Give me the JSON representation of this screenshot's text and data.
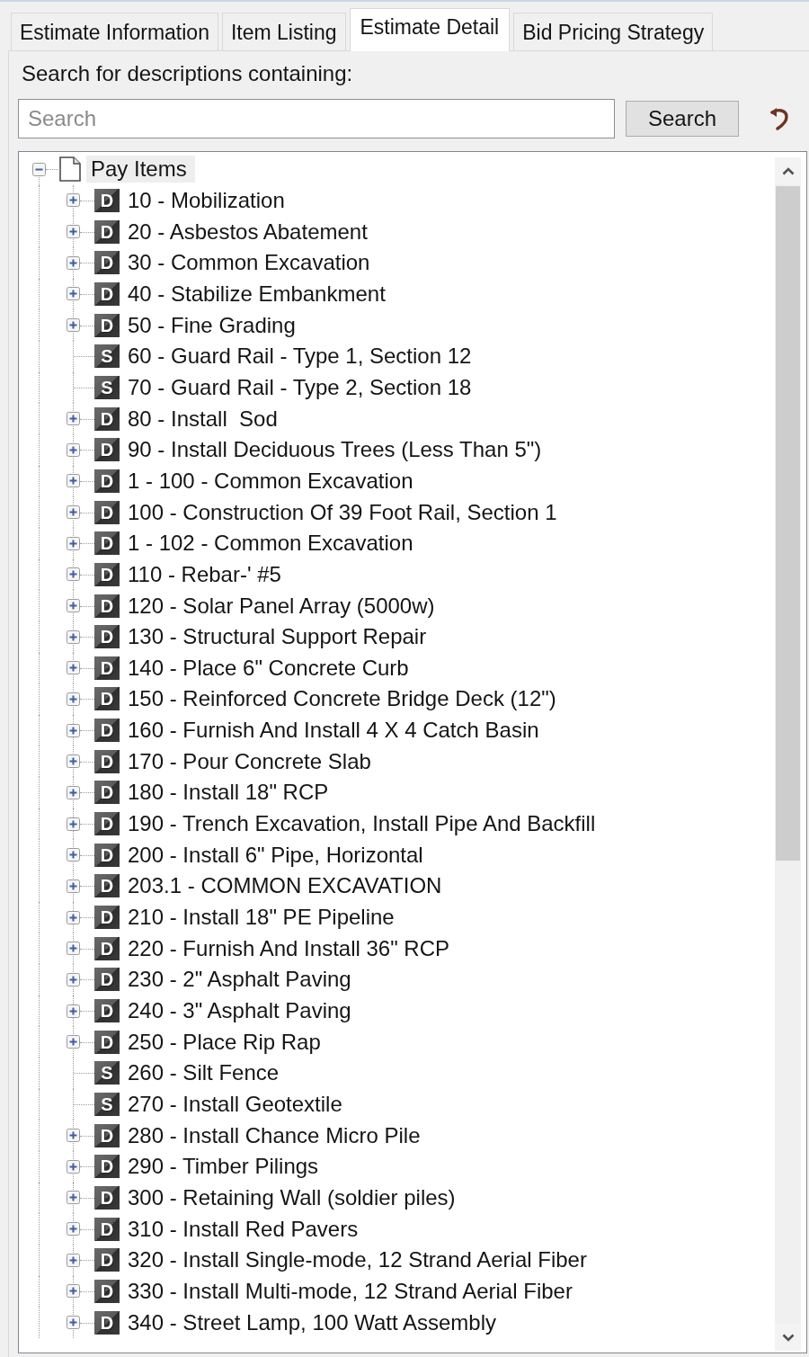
{
  "tabs": [
    {
      "label": "Estimate Information",
      "selected": false
    },
    {
      "label": "Item Listing",
      "selected": false
    },
    {
      "label": "Estimate Detail",
      "selected": true
    },
    {
      "label": "Bid Pricing Strategy",
      "selected": false
    }
  ],
  "search": {
    "label": "Search for descriptions containing:",
    "placeholder": "Search",
    "button": "Search"
  },
  "tree": [
    {
      "kind": "document",
      "label": "Pay Items",
      "expanded": true,
      "selected": true,
      "children": [
        {
          "kind": "item",
          "badge": "D",
          "label": "10 - Mobilization",
          "expanded": false,
          "selected": false
        },
        {
          "kind": "item",
          "badge": "D",
          "label": "20 - Asbestos Abatement",
          "expanded": false,
          "selected": false
        },
        {
          "kind": "item",
          "badge": "D",
          "label": "30 - Common Excavation",
          "expanded": false,
          "selected": false
        },
        {
          "kind": "item",
          "badge": "D",
          "label": "40 - Stabilize Embankment",
          "expanded": false,
          "selected": false
        },
        {
          "kind": "item",
          "badge": "D",
          "label": "50 - Fine Grading",
          "expanded": false,
          "selected": false
        },
        {
          "kind": "item",
          "badge": "S",
          "label": "60 - Guard Rail - Type 1, Section 12",
          "selected": false
        },
        {
          "kind": "item",
          "badge": "S",
          "label": "70 - Guard Rail - Type 2, Section 18",
          "selected": false
        },
        {
          "kind": "item",
          "badge": "D",
          "label": "80 - Install  Sod",
          "expanded": false,
          "selected": false
        },
        {
          "kind": "item",
          "badge": "D",
          "label": "90 - Install Deciduous Trees (Less Than 5\")",
          "expanded": false,
          "selected": false
        },
        {
          "kind": "item",
          "badge": "D",
          "label": "1 - 100 - Common Excavation",
          "expanded": false,
          "selected": false
        },
        {
          "kind": "item",
          "badge": "D",
          "label": "100 - Construction Of 39 Foot Rail, Section 1",
          "expanded": false,
          "selected": false
        },
        {
          "kind": "item",
          "badge": "D",
          "label": "1 - 102 - Common Excavation",
          "expanded": false,
          "selected": false
        },
        {
          "kind": "item",
          "badge": "D",
          "label": "110 - Rebar-' #5",
          "expanded": false,
          "selected": false
        },
        {
          "kind": "item",
          "badge": "D",
          "label": "120 - Solar Panel Array (5000w)",
          "expanded": false,
          "selected": false
        },
        {
          "kind": "item",
          "badge": "D",
          "label": "130 - Structural Support Repair",
          "expanded": false,
          "selected": false
        },
        {
          "kind": "item",
          "badge": "D",
          "label": "140 - Place 6\" Concrete Curb",
          "expanded": false,
          "selected": false
        },
        {
          "kind": "item",
          "badge": "D",
          "label": "150 - Reinforced Concrete Bridge Deck (12\")",
          "expanded": false,
          "selected": false
        },
        {
          "kind": "item",
          "badge": "D",
          "label": "160 - Furnish And Install 4 X 4 Catch Basin",
          "expanded": false,
          "selected": false
        },
        {
          "kind": "item",
          "badge": "D",
          "label": "170 - Pour Concrete Slab",
          "expanded": false,
          "selected": false
        },
        {
          "kind": "item",
          "badge": "D",
          "label": "180 - Install 18\" RCP",
          "expanded": false,
          "selected": false
        },
        {
          "kind": "item",
          "badge": "D",
          "label": "190 - Trench Excavation, Install Pipe And Backfill",
          "expanded": false,
          "selected": false
        },
        {
          "kind": "item",
          "badge": "D",
          "label": "200 - Install 6\" Pipe, Horizontal",
          "expanded": false,
          "selected": false
        },
        {
          "kind": "item",
          "badge": "D",
          "label": "203.1 - COMMON EXCAVATION",
          "expanded": false,
          "selected": false
        },
        {
          "kind": "item",
          "badge": "D",
          "label": "210 - Install 18\" PE Pipeline",
          "expanded": false,
          "selected": false
        },
        {
          "kind": "item",
          "badge": "D",
          "label": "220 - Furnish And Install 36\" RCP",
          "expanded": false,
          "selected": false
        },
        {
          "kind": "item",
          "badge": "D",
          "label": "230 - 2\" Asphalt Paving",
          "expanded": false,
          "selected": false
        },
        {
          "kind": "item",
          "badge": "D",
          "label": "240 - 3\" Asphalt Paving",
          "expanded": false,
          "selected": false
        },
        {
          "kind": "item",
          "badge": "D",
          "label": "250 - Place Rip Rap",
          "expanded": false,
          "selected": false
        },
        {
          "kind": "item",
          "badge": "S",
          "label": "260 - Silt Fence",
          "selected": false
        },
        {
          "kind": "item",
          "badge": "S",
          "label": "270 - Install Geotextile",
          "selected": false
        },
        {
          "kind": "item",
          "badge": "D",
          "label": "280 - Install Chance Micro Pile",
          "expanded": false,
          "selected": false
        },
        {
          "kind": "item",
          "badge": "D",
          "label": "290 - Timber Pilings",
          "expanded": false,
          "selected": false
        },
        {
          "kind": "item",
          "badge": "D",
          "label": "300 - Retaining Wall (soldier piles)",
          "expanded": false,
          "selected": false
        },
        {
          "kind": "item",
          "badge": "D",
          "label": "310 - Install Red Pavers",
          "expanded": false,
          "selected": false
        },
        {
          "kind": "item",
          "badge": "D",
          "label": "320 - Install Single-mode, 12 Strand Aerial Fiber",
          "expanded": false,
          "selected": false
        },
        {
          "kind": "item",
          "badge": "D",
          "label": "330 - Install Multi-mode, 12 Strand Aerial Fiber",
          "expanded": false,
          "selected": false
        },
        {
          "kind": "item",
          "badge": "D",
          "label": "340 - Street Lamp, 100 Watt Assembly",
          "expanded": false,
          "selected": false
        }
      ]
    }
  ]
}
